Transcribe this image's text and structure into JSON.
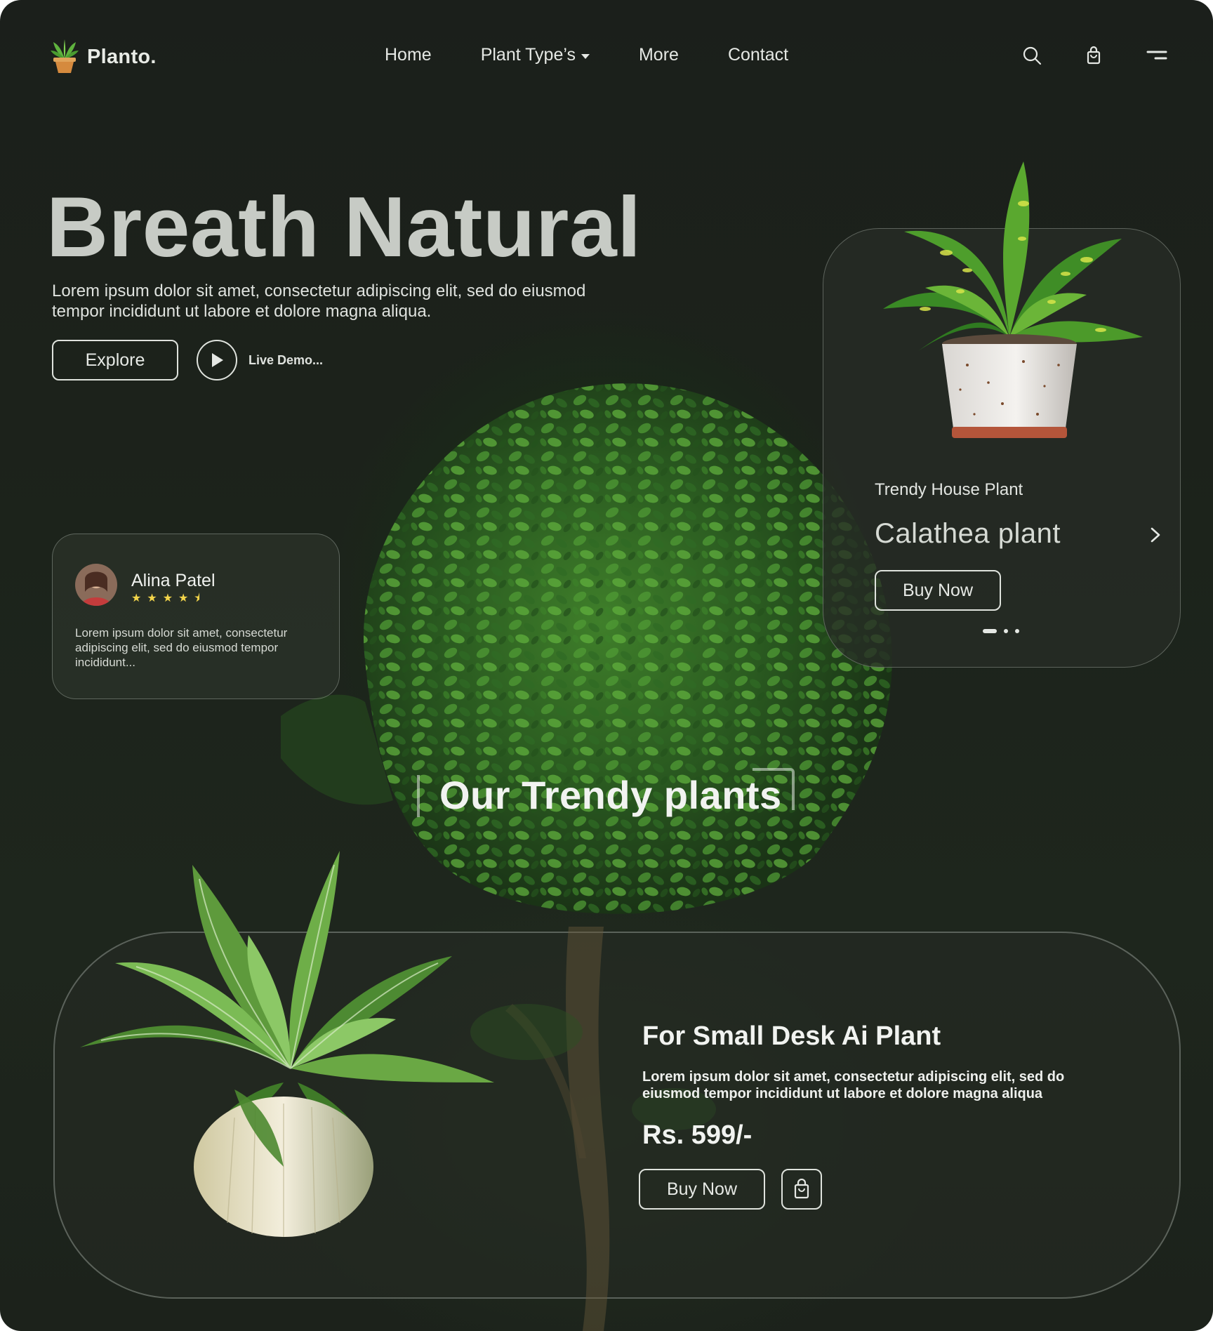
{
  "nav": {
    "brand": "Planto.",
    "items": [
      {
        "label": "Home"
      },
      {
        "label": "Plant Type’s"
      },
      {
        "label": "More"
      },
      {
        "label": "Contact"
      }
    ],
    "icons": [
      "search-icon",
      "shopping-bag-icon",
      "menu-icon"
    ]
  },
  "hero": {
    "title": "Breath Natural",
    "description": "Lorem ipsum dolor sit amet, consectetur adipiscing elit, sed do eiusmod tempor incididunt ut labore et dolore magna aliqua.",
    "explore_label": "Explore",
    "live_demo_label": "Live Demo..."
  },
  "review": {
    "name": "Alina Patel",
    "rating": 4.5,
    "stars": "★★★★⯨",
    "text": "Lorem ipsum dolor sit amet, consectetur adipiscing elit, sed do eiusmod tempor incididunt..."
  },
  "featured": {
    "subtitle": "Trendy House Plant",
    "name": "Calathea plant",
    "buy_label": "Buy Now",
    "slides_total": 3,
    "slide_active": 1
  },
  "section": {
    "title": "Our Trendy plants"
  },
  "product": {
    "title": "For Small Desk Ai Plant",
    "description": "Lorem ipsum dolor sit amet, consectetur adipiscing elit, sed do eiusmod tempor incididunt ut labore et dolore magna aliqua",
    "price": "Rs. 599/-",
    "buy_label": "Buy Now"
  },
  "colors": {
    "background": "#1c221b",
    "text": "#e9ece8",
    "star": "#f2d44a",
    "leaf": "#3f8a2a"
  }
}
